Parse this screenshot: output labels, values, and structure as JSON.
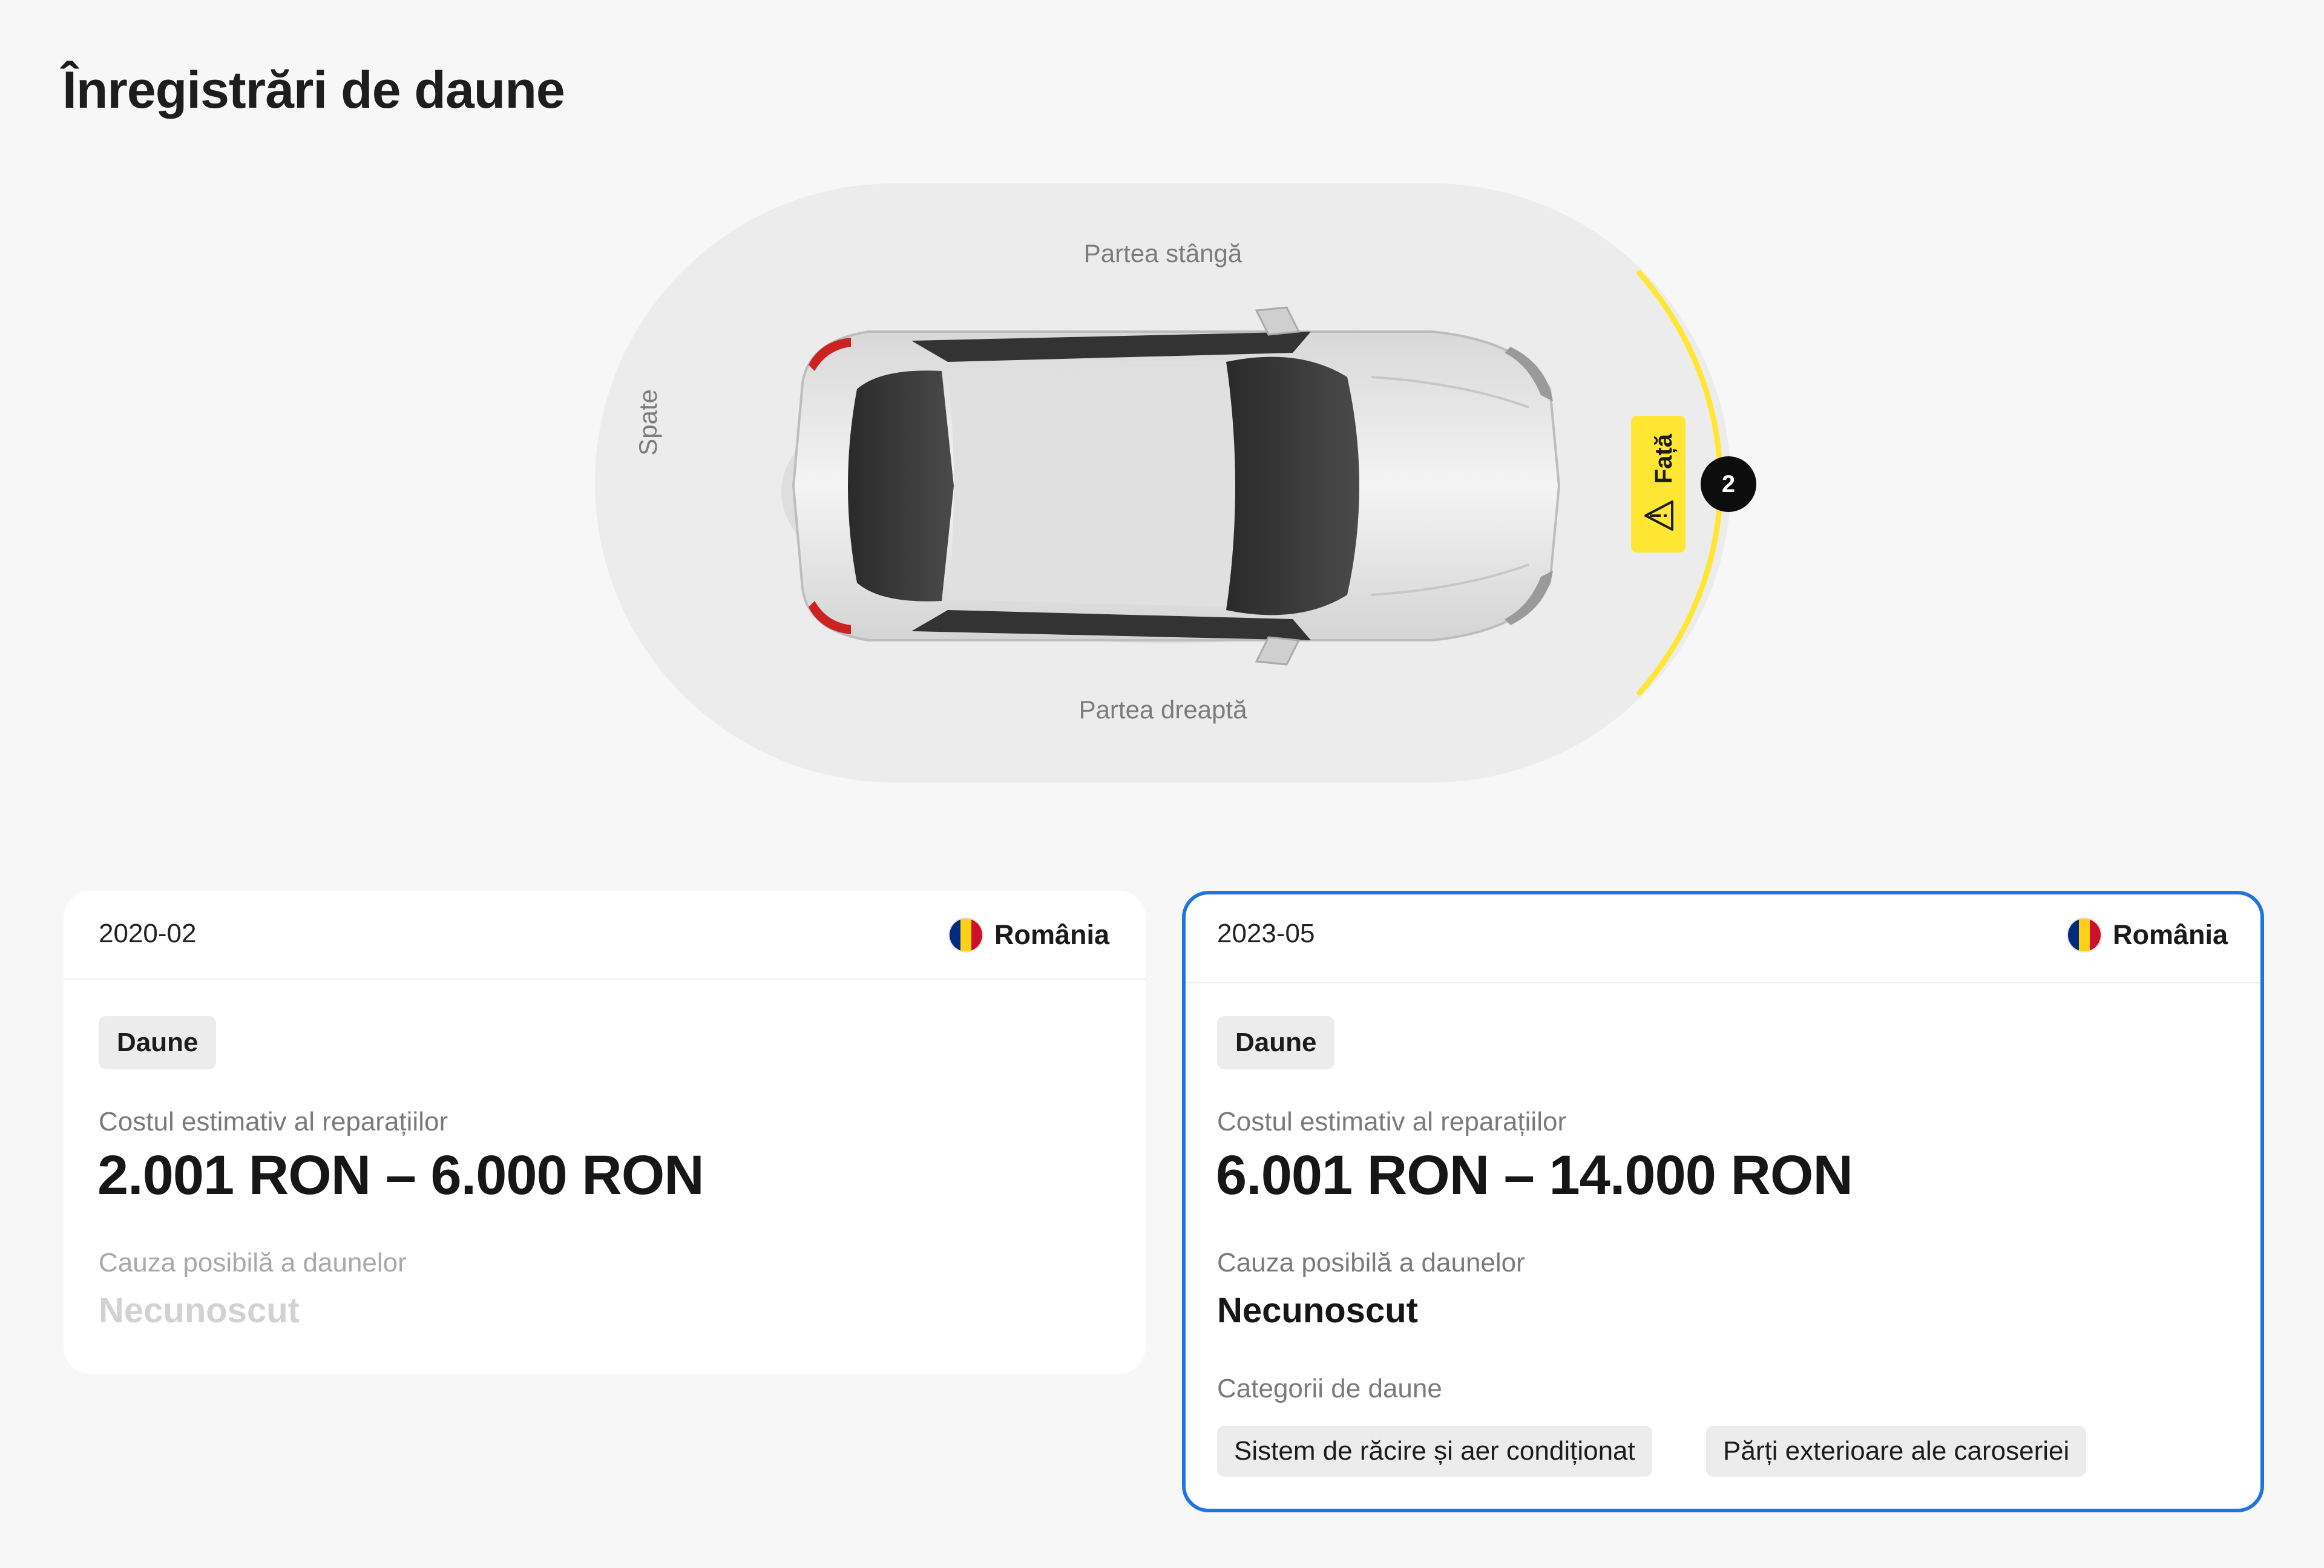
{
  "page": {
    "title": "Înregistrări de daune"
  },
  "diagram": {
    "label_left_side": "Partea stângă",
    "label_right_side": "Partea dreaptă",
    "label_rear": "Spate",
    "label_front": "Față",
    "front_damage_count": "2",
    "highlight_color": "#ffe632",
    "icons": [
      "warning-triangle-icon"
    ]
  },
  "records": [
    {
      "date": "2020-02",
      "country": "România",
      "flag_colors": [
        "#002b7f",
        "#fcd116",
        "#ce1126"
      ],
      "badge": "Daune",
      "cost_label": "Costul estimativ al reparațiilor",
      "cost_value": "2.001 RON – 6.000 RON",
      "cause_label": "Cauza posibilă a daunelor",
      "cause_value": "Necunoscut"
    },
    {
      "date": "2023-05",
      "country": "România",
      "flag_colors": [
        "#002b7f",
        "#fcd116",
        "#ce1126"
      ],
      "badge": "Daune",
      "cost_label": "Costul estimativ al reparațiilor",
      "cost_value": "6.001 RON – 14.000 RON",
      "cause_label": "Cauza posibilă a daunelor",
      "cause_value": "Necunoscut",
      "categories_label": "Categorii de daune",
      "categories": [
        "Sistem de răcire și aer condiționat",
        "Părți exterioare ale caroseriei"
      ],
      "selected": true,
      "selected_border_color": "#1f74e0"
    }
  ]
}
